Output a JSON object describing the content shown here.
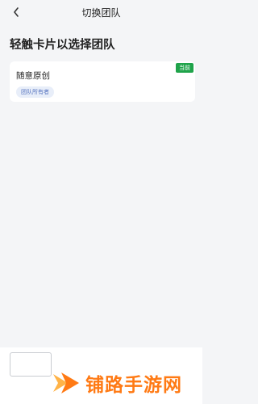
{
  "header": {
    "title": "切换团队"
  },
  "subtitle": "轻触卡片以选择团队",
  "teams": [
    {
      "name": "随意原创",
      "role": "团队所有者",
      "status": "当前"
    }
  ],
  "watermark": {
    "text": "铺路手游网"
  },
  "colors": {
    "accent_green": "#1fa34a",
    "role_badge_bg": "#e8eef9",
    "role_badge_text": "#5a77c1",
    "watermark_orange": "#ff7a14",
    "background": "#f4f5f7"
  }
}
